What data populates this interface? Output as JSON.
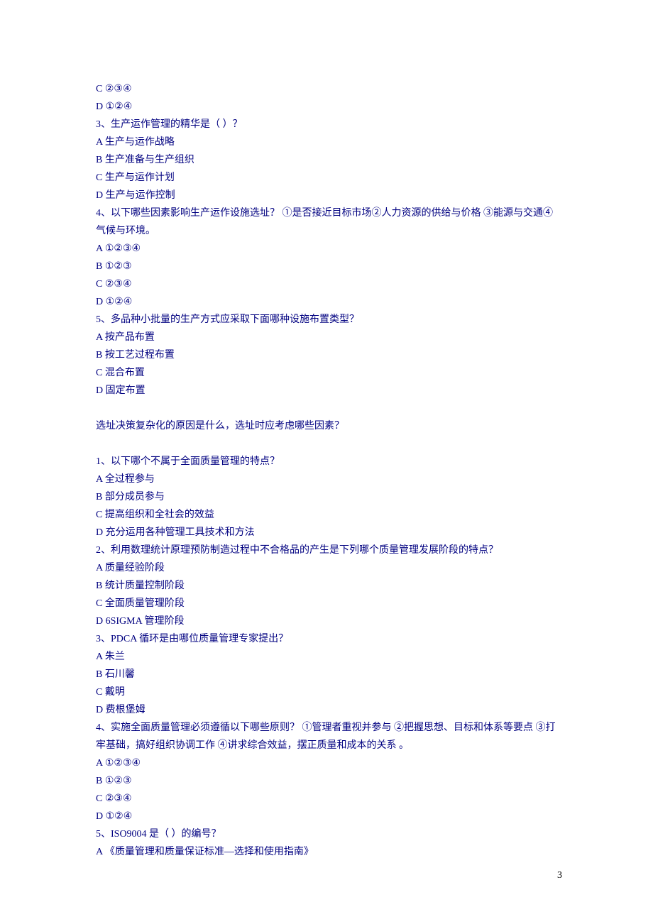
{
  "lines": [
    "C ②③④",
    "D ①②④",
    "3、生产运作管理的精华是（ ）？",
    "A 生产与运作战略",
    "B 生产准备与生产组织",
    "C 生产与运作计划",
    "D 生产与运作控制",
    "4、以下哪些因素影响生产运作设施选址？ ①是否接近目标市场②人力资源的供给与价格 ③能源与交通④气候与环境。",
    "A ①②③④",
    "B ①②③",
    "C ②③④",
    "D ①②④",
    "5、多品种小批量的生产方式应采取下面哪种设施布置类型？",
    "A 按产品布置",
    "B 按工艺过程布置",
    "C 混合布置",
    "D 固定布置",
    "",
    "选址决策复杂化的原因是什么，选址时应考虑哪些因素？",
    "",
    "1、以下哪个不属于全面质量管理的特点？",
    "A 全过程参与",
    "B 部分成员参与",
    "C 提高组织和全社会的效益",
    "D 充分运用各种管理工具技术和方法",
    "2、利用数理统计原理预防制造过程中不合格品的产生是下列哪个质量管理发展阶段的特点？",
    "A 质量经验阶段",
    "B 统计质量控制阶段",
    "C 全面质量管理阶段",
    "D 6SIGMA 管理阶段",
    "3、PDCA 循环是由哪位质量管理专家提出？",
    "A 朱兰",
    "B 石川馨",
    "C 戴明",
    "D 费根堡姆",
    "4、实施全面质量管理必须遵循以下哪些原则？ ①管理者重视并参与 ②把握思想、目标和体系等要点 ③打牢基础，搞好组织协调工作 ④讲求综合效益，摆正质量和成本的关系 。",
    "A ①②③④",
    "B ①②③",
    "C ②③④",
    "D ①②④",
    "5、ISO9004 是（ ）的编号？",
    "A 《质量管理和质量保证标准—选择和使用指南》"
  ],
  "page_number": "3"
}
